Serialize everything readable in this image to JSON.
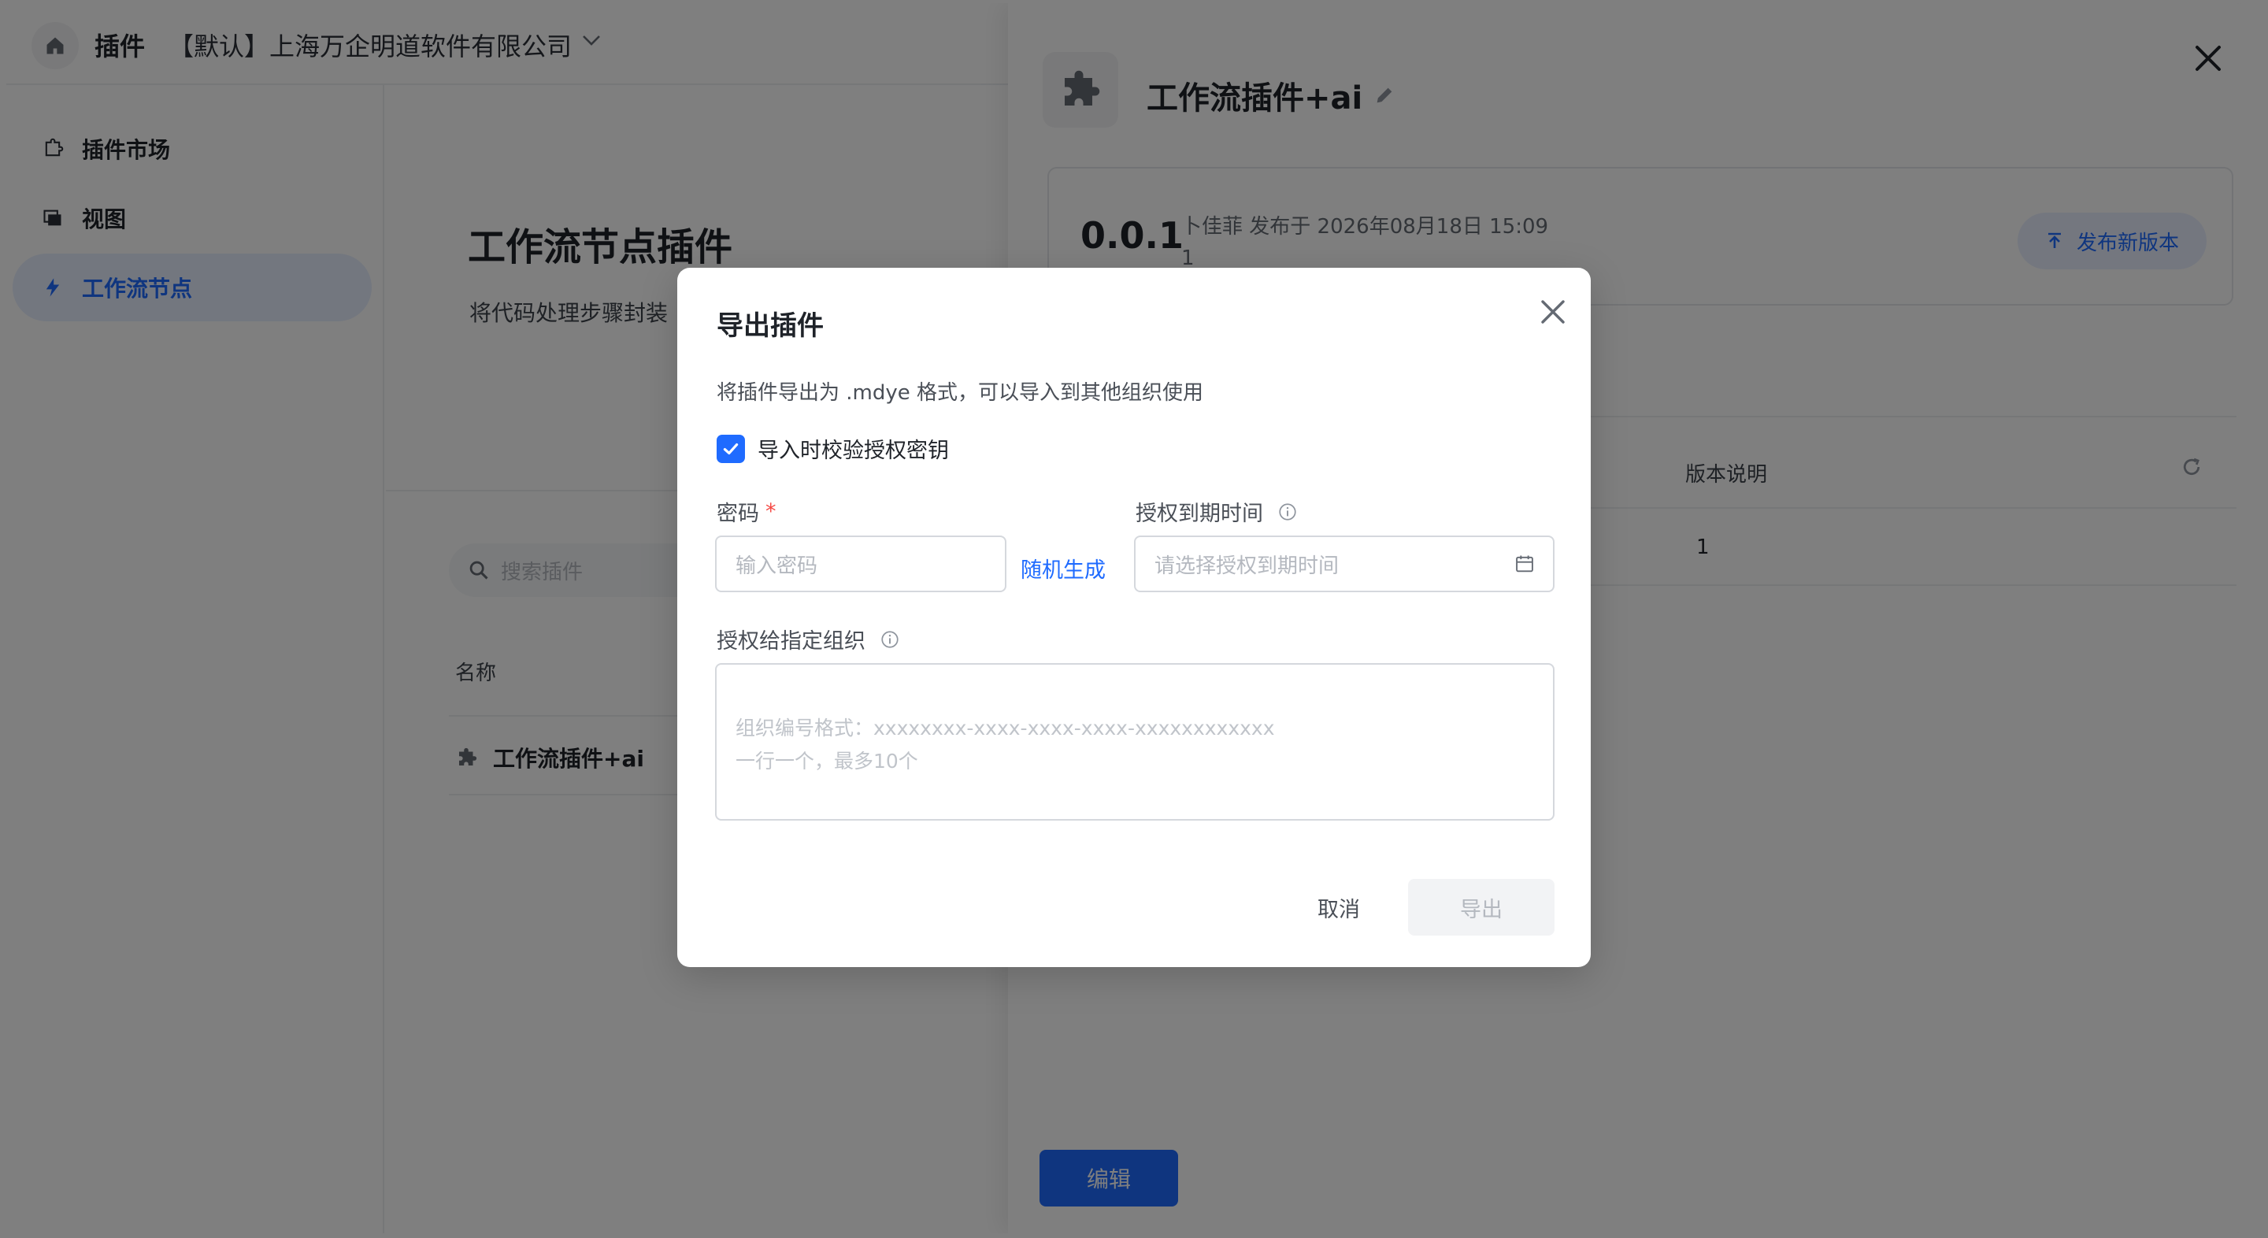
{
  "topbar": {
    "app_title": "插件",
    "org_name": "【默认】上海万企明道软件有限公司"
  },
  "sidebar": {
    "items": [
      {
        "label": "插件市场",
        "icon": "plugin-market-icon"
      },
      {
        "label": "视图",
        "icon": "view-icon"
      },
      {
        "label": "工作流节点",
        "icon": "workflow-node-icon",
        "active": true
      }
    ]
  },
  "main": {
    "title": "工作流节点插件",
    "description": "将代码处理步骤封装",
    "search_placeholder": "搜索插件",
    "column_name": "名称",
    "rows": [
      {
        "name": "工作流插件+ai"
      }
    ]
  },
  "drawer": {
    "plugin_name": "工作流插件+ai",
    "version": "0.0.1",
    "publish_info": "卜佳菲 发布于 2026年08月18日 15:09",
    "version_note": "1",
    "publish_button": "发布新版本",
    "table": {
      "header_note": "版本说明",
      "note_value": "1"
    },
    "edit_button": "编辑"
  },
  "modal": {
    "title": "导出插件",
    "description": "将插件导出为 .mdye 格式，可以导入到其他组织使用",
    "checkbox_label": "导入时校验授权密钥",
    "checkbox_checked": true,
    "password_label": "密码",
    "required_mark": "*",
    "password_placeholder": "输入密码",
    "random_generate": "随机生成",
    "expiry_label": "授权到期时间",
    "expiry_placeholder": "请选择授权到期时间",
    "org_label": "授权给指定组织",
    "org_placeholder": "组织编号格式：xxxxxxxx-xxxx-xxxx-xxxx-xxxxxxxxxxxx\n一行一个，最多10个",
    "cancel_button": "取消",
    "export_button": "导出"
  },
  "colors": {
    "primary": "#1f6bff",
    "required": "#f54a45",
    "mask": "rgba(0,0,0,0.5)"
  }
}
